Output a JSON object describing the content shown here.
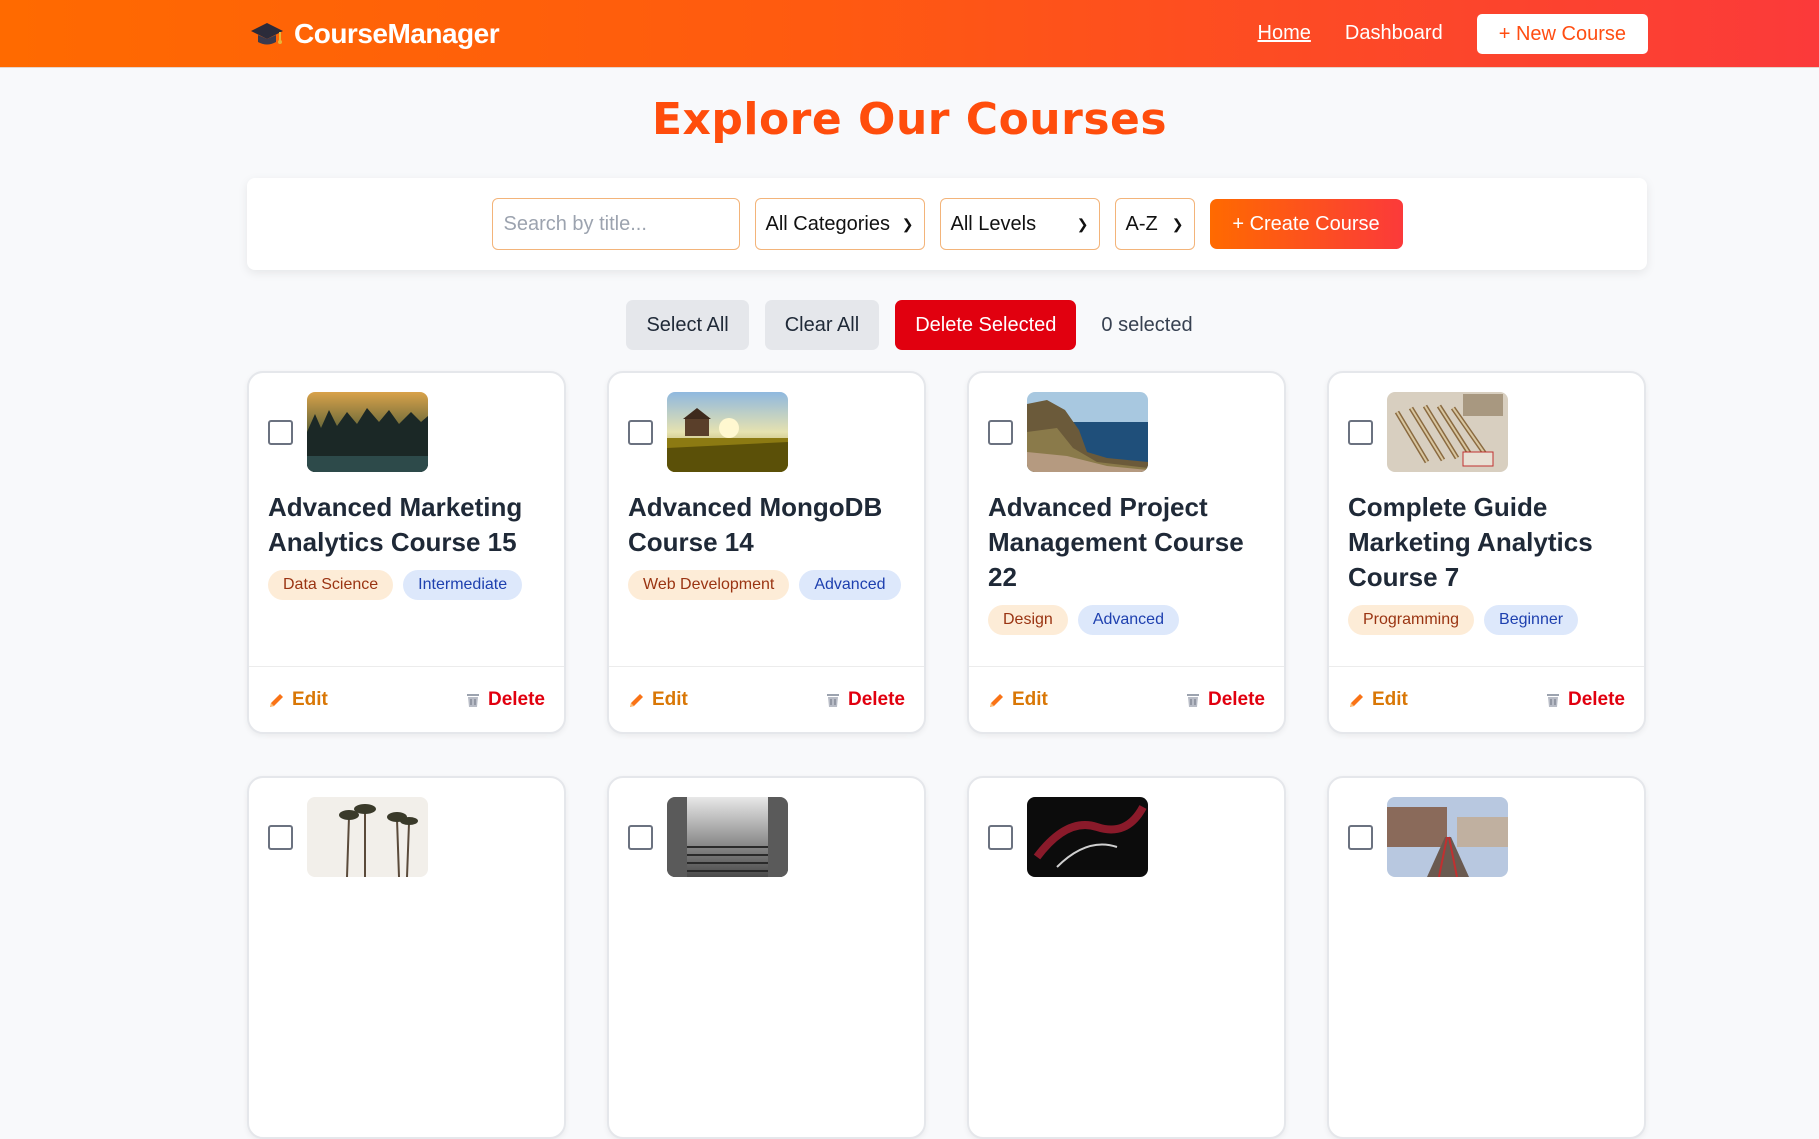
{
  "app": {
    "brand": "CourseManager",
    "nav": {
      "home": "Home",
      "dashboard": "Dashboard",
      "new_course": "+ New Course"
    }
  },
  "page": {
    "title": "Explore Our Courses"
  },
  "filters": {
    "search_placeholder": "Search by title...",
    "category": "All Categories",
    "level": "All Levels",
    "sort": "A-Z",
    "create_label": "+ Create Course"
  },
  "bulk": {
    "select_all": "Select All",
    "clear_all": "Clear All",
    "delete_selected": "Delete Selected",
    "selected_count": "0 selected"
  },
  "card_actions": {
    "edit": "Edit",
    "delete": "Delete"
  },
  "courses": [
    {
      "title": "Advanced Marketing Analytics Course 15",
      "category": "Data Science",
      "level": "Intermediate"
    },
    {
      "title": "Advanced MongoDB Course 14",
      "category": "Web Development",
      "level": "Advanced"
    },
    {
      "title": "Advanced Project Management Course 22",
      "category": "Design",
      "level": "Advanced"
    },
    {
      "title": "Complete Guide Marketing Analytics Course 7",
      "category": "Programming",
      "level": "Beginner"
    }
  ],
  "colors": {
    "accent": "#ff5a10",
    "danger": "#e1000f",
    "edit": "#d97706"
  }
}
